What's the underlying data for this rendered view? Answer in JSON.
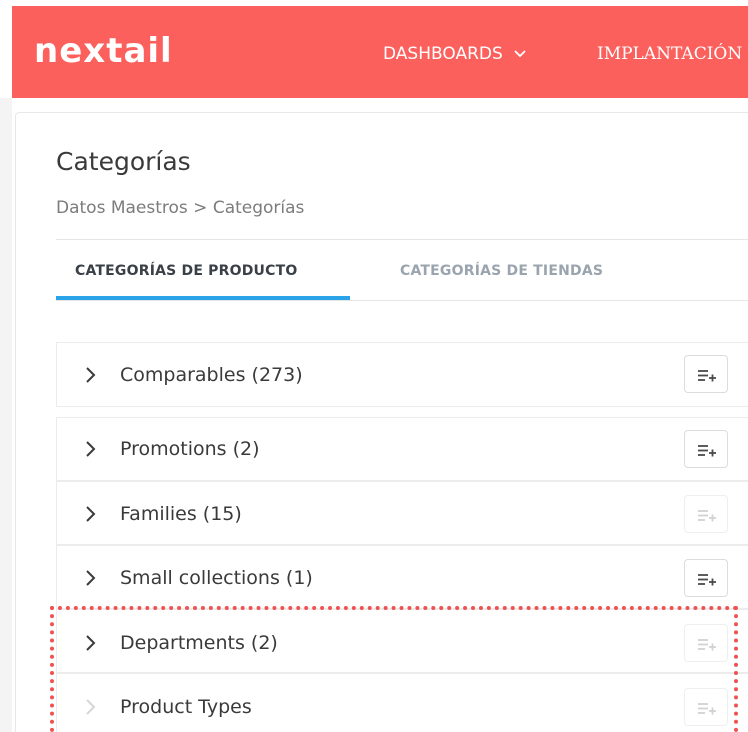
{
  "app": {
    "logo": "nextail"
  },
  "nav": {
    "dashboards": "DASHBOARDS",
    "implantacion": "IMPLANTACIÓN"
  },
  "page": {
    "title": "Categorías",
    "breadcrumb": "Datos Maestros > Categorías"
  },
  "tabs": [
    {
      "label": "CATEGORÍAS DE PRODUCTO",
      "active": true
    },
    {
      "label": "CATEGORÍAS DE TIENDAS",
      "active": false
    }
  ],
  "categories": [
    {
      "label": "Comparables (273)",
      "expandable": true,
      "add_enabled": true
    },
    {
      "label": "Promotions (2)",
      "expandable": true,
      "add_enabled": true
    },
    {
      "label": "Families (15)",
      "expandable": true,
      "add_enabled": false
    },
    {
      "label": "Small collections (1)",
      "expandable": true,
      "add_enabled": true
    },
    {
      "label": "Departments (2)",
      "expandable": true,
      "add_enabled": false
    },
    {
      "label": "Product Types",
      "expandable": false,
      "add_enabled": false
    }
  ],
  "colors": {
    "brand": "#fb605d",
    "tab_active": "#2aa3e8",
    "highlight": "#f05252"
  }
}
